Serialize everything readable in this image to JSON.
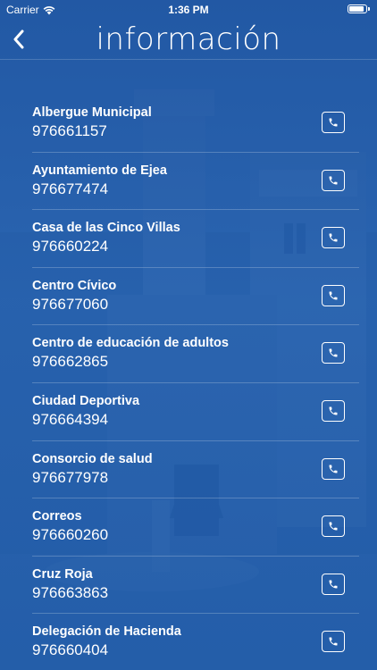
{
  "status_bar": {
    "carrier": "Carrier",
    "time": "1:36 PM",
    "battery_level": 0.9
  },
  "nav": {
    "title": "información",
    "back_icon": "chevron-left-icon"
  },
  "contacts": [
    {
      "name": "Albergue Municipal",
      "phone": "976661157"
    },
    {
      "name": "Ayuntamiento de Ejea",
      "phone": "976677474"
    },
    {
      "name": "Casa de las Cinco Villas",
      "phone": "976660224"
    },
    {
      "name": "Centro Cívico",
      "phone": "976677060"
    },
    {
      "name": "Centro de educación de adultos",
      "phone": "976662865"
    },
    {
      "name": "Ciudad Deportiva",
      "phone": "976664394"
    },
    {
      "name": "Consorcio de salud",
      "phone": "976677978"
    },
    {
      "name": "Correos",
      "phone": "976660260"
    },
    {
      "name": "Cruz Roja",
      "phone": "976663863"
    },
    {
      "name": "Delegación de Hacienda",
      "phone": "976660404"
    }
  ],
  "call_icon": "phone-icon",
  "colors": {
    "background": "#1f5aa7",
    "text": "#ffffff"
  }
}
